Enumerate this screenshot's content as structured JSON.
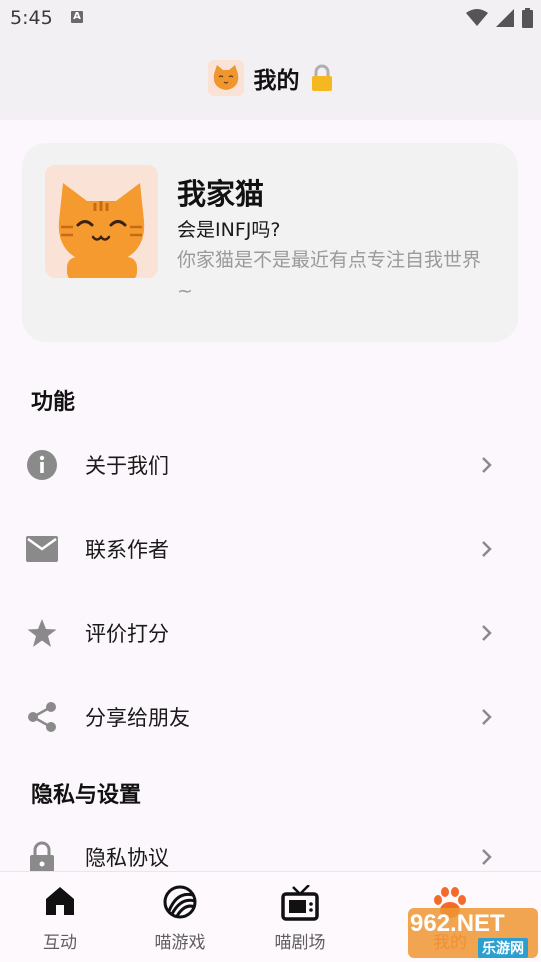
{
  "status_bar": {
    "time": "5:45",
    "notification_icon_text": "A"
  },
  "header": {
    "title": "我的"
  },
  "profile": {
    "name": "我家猫",
    "subtitle": "会是INFJ吗?",
    "description": "你家猫是不是最近有点专注自我世界~"
  },
  "sections": {
    "features_title": "功能",
    "privacy_title": "隐私与设置"
  },
  "menu": [
    {
      "label": "关于我们",
      "icon": "info-icon"
    },
    {
      "label": "联系作者",
      "icon": "mail-icon"
    },
    {
      "label": "评价打分",
      "icon": "star-icon"
    },
    {
      "label": "分享给朋友",
      "icon": "share-icon"
    },
    {
      "label": "隐私协议",
      "icon": "lock-icon"
    }
  ],
  "bottom_nav": [
    {
      "label": "互动",
      "icon": "home-icon"
    },
    {
      "label": "喵游戏",
      "icon": "ball-icon"
    },
    {
      "label": "喵剧场",
      "icon": "tv-icon"
    },
    {
      "label": "我的",
      "icon": "paw-icon",
      "active": true
    }
  ],
  "watermark": {
    "text": "962.NET",
    "subtext": "乐游网"
  },
  "colors": {
    "accent_orange": "#f5a524",
    "icon_gray": "#8a8a8a",
    "background": "#fcf7fc"
  }
}
